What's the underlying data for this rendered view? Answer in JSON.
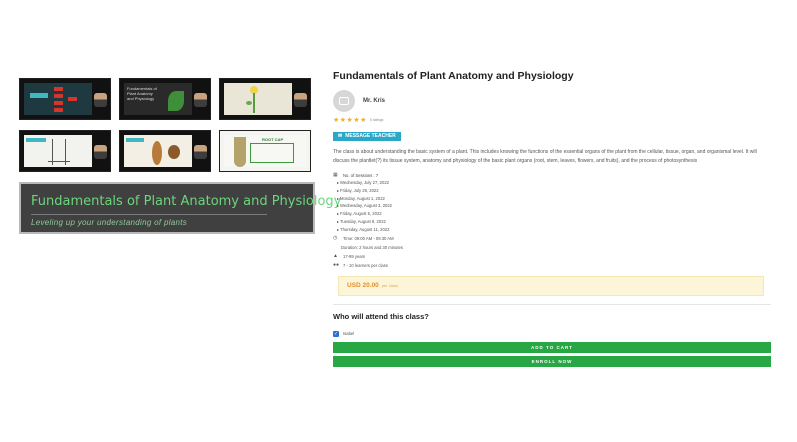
{
  "gallery": {
    "thumbnails": [
      {
        "label": ""
      },
      {
        "label": "Fundamentals of Plant Anatomy and Physiology"
      },
      {
        "label": ""
      },
      {
        "label": ""
      },
      {
        "label": ""
      },
      {
        "label": "ROOT CAP"
      }
    ],
    "hero_title": "Fundamentals of Plant Anatomy and Physiology",
    "hero_subtitle": "Leveling up your understanding of plants"
  },
  "course": {
    "title": "Fundamentals of Plant Anatomy and Physiology",
    "teacher_name": "Mr. Kris",
    "stars": "★★★★★",
    "ratings_count": "0 ratings",
    "message_button": "MESSAGE TEACHER",
    "description": "The class is about understanding the basic system of a plant. This includes knowing the functions of the essential organs of the plant from the cellular, tissue, organ, and organismal level. It will discuss the plantlet(?) its tissue system, anatomy and physiology of the basic plant organs (root, stem, leaves, flowers, and fruits), and the process of photosynthesis",
    "sessions_label": "No. of Sessions : 7",
    "dates": [
      "Wednesday, July 27, 2022",
      "Friday, July 29, 2022",
      "Monday, August 1, 2022",
      "Wednesday, August 3, 2022",
      "Friday, August 5, 2022",
      "Tuesday, August 9, 2022",
      "Thursday, August 11, 2022"
    ],
    "time": "Time: 09:00 AM - 09:30 AM",
    "duration": "Duration: 2 hours and 30 minutes",
    "ages": "17-99 years",
    "learners": "7 - 10 learners per class",
    "price": "USD 20.00",
    "price_unit": "per class"
  },
  "attend": {
    "heading": "Who will attend this class?",
    "attendee_name": "Isabel",
    "checked_mark": "✓",
    "add_to_cart": "ADD TO CART",
    "enroll_now": "ENROLL NOW"
  },
  "colors": {
    "accent_teal": "#2ba7c8",
    "price_orange": "#e88d2b",
    "button_green": "#28a745",
    "star_gold": "#f2b01e"
  },
  "icons": {
    "sessions": "calendar-icon",
    "time": "clock-icon",
    "ages": "graduation-cap-icon",
    "learners": "users-icon",
    "message": "message-icon"
  }
}
